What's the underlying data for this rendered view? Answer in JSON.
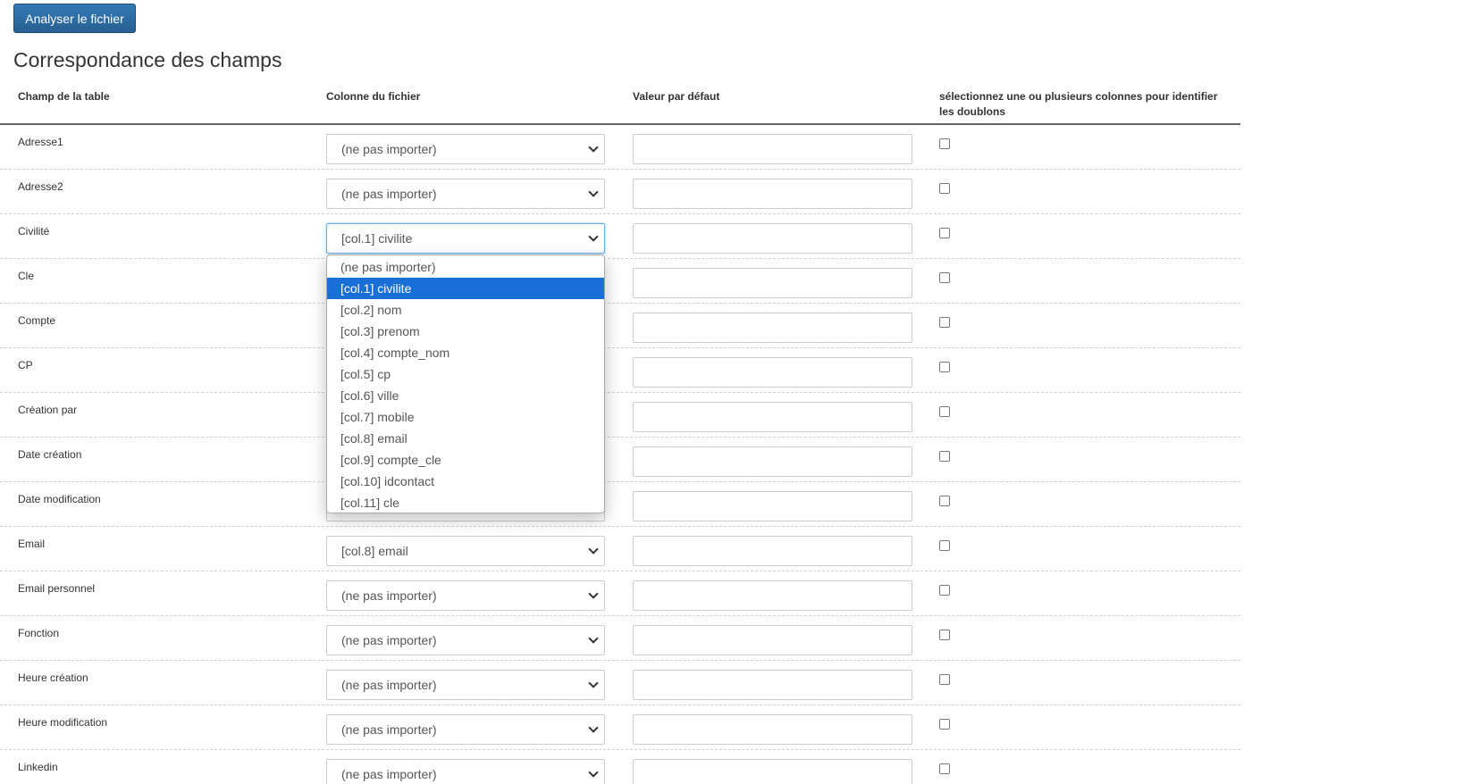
{
  "toolbar": {
    "analyse_label": "Analyser le fichier"
  },
  "section_title": "Correspondance des champs",
  "table": {
    "headers": [
      "Champ de la table",
      "Colonne du fichier",
      "Valeur par défaut",
      "sélectionnez une ou plusieurs colonnes pour identifier les doublons"
    ],
    "rows": [
      {
        "field": "Adresse1",
        "column": "(ne pas importer)"
      },
      {
        "field": "Adresse2",
        "column": "(ne pas importer)"
      },
      {
        "field": "Civilité",
        "column": "[col.1] civilite"
      },
      {
        "field": "Cle",
        "column": ""
      },
      {
        "field": "Compte",
        "column": ""
      },
      {
        "field": "CP",
        "column": ""
      },
      {
        "field": "Création par",
        "column": ""
      },
      {
        "field": "Date création",
        "column": ""
      },
      {
        "field": "Date modification",
        "column": ""
      },
      {
        "field": "Email",
        "column": "[col.8] email"
      },
      {
        "field": "Email personnel",
        "column": "(ne pas importer)"
      },
      {
        "field": "Fonction",
        "column": "(ne pas importer)"
      },
      {
        "field": "Heure création",
        "column": "(ne pas importer)"
      },
      {
        "field": "Heure modification",
        "column": "(ne pas importer)"
      },
      {
        "field": "Linkedin",
        "column": "(ne pas importer)"
      }
    ]
  },
  "dropdown": {
    "open_for_row": "Civilité",
    "selected": "[col.1] civilite",
    "options": [
      "(ne pas importer)",
      "[col.1] civilite",
      "[col.2] nom",
      "[col.3] prenom",
      "[col.4] compte_nom",
      "[col.5] cp",
      "[col.6] ville",
      "[col.7] mobile",
      "[col.8] email",
      "[col.9] compte_cle",
      "[col.10] idcontact",
      "[col.11] cle"
    ]
  },
  "colors": {
    "primary_button": "#2e6da4",
    "selected_option": "#1a6fd6",
    "focus_border": "#66afe9"
  }
}
